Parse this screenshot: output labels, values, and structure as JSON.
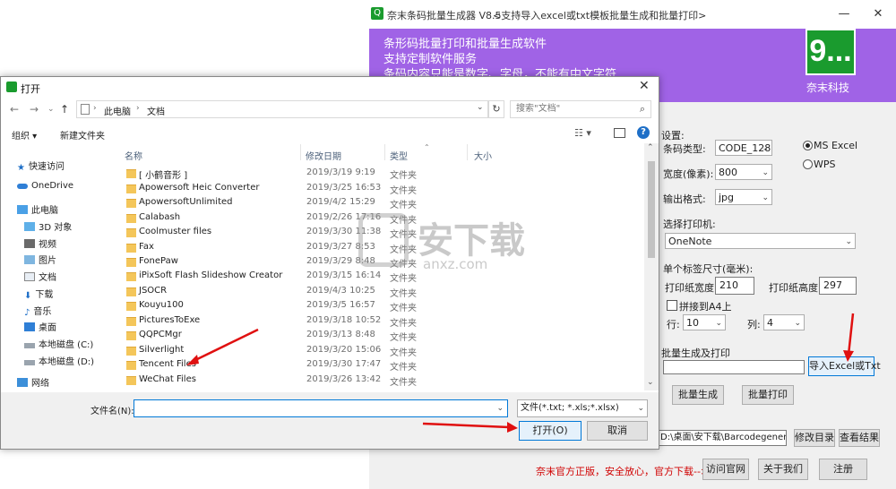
{
  "app": {
    "title": "奈末条码批量生成器 V8.5",
    "subtitle": "<支持导入excel或txt模板批量生成和批量打印>",
    "banner_lines": [
      "条形码批量打印和批量生成软件",
      "支持定制软件服务",
      "条码内容只能是数字、字母，不能有中文字符"
    ],
    "logo": "9...",
    "company": "奈末科技",
    "settings_label": "设置:",
    "barcode_type_label": "条码类型:",
    "barcode_type_value": "CODE_128",
    "width_label": "宽度(像素):",
    "width_value": "800",
    "output_format_label": "输出格式:",
    "output_format_value": "jpg",
    "radio_excel": "MS  Excel",
    "radio_wps": "WPS",
    "printer_label": "选择打印机:",
    "printer_value": "OneNote",
    "label_size_label": "单个标签尺寸(毫米):",
    "paper_width_label": "打印纸宽度:",
    "paper_width_value": "210",
    "paper_height_label": "打印纸高度:",
    "paper_height_value": "297",
    "a4_label": "拼接到A4上",
    "rows_label": "行:",
    "rows_value": "10",
    "cols_label": "列:",
    "cols_value": "4",
    "batch_label": "批量生成及打印",
    "import_button": "导入Excel或Txt",
    "batch_generate_button": "批量生成",
    "batch_print_button": "批量打印",
    "output_path": "D:\\桌面\\安下载\\Barcodegenerato",
    "change_dir_button": "修改目录",
    "view_result_button": "查看结果",
    "footer_text": "奈末官方正版，安全放心，官方下载-->",
    "visit_site_button": "访问官网",
    "about_button": "关于我们",
    "register_button": "注册"
  },
  "dialog": {
    "title": "打开",
    "breadcrumb": [
      "此电脑",
      "文档"
    ],
    "search_placeholder": "搜索\"文档\"",
    "organize": "组织 ▾",
    "new_folder": "新建文件夹",
    "nav_items": [
      {
        "label": "快速访问",
        "icon": "star-icon"
      },
      {
        "label": "OneDrive",
        "icon": "cloud-icon"
      },
      {
        "label": "此电脑",
        "icon": "computer-icon"
      },
      {
        "label": "3D 对象",
        "icon": "cube-icon"
      },
      {
        "label": "视频",
        "icon": "video-icon"
      },
      {
        "label": "图片",
        "icon": "picture-icon"
      },
      {
        "label": "文档",
        "icon": "document-icon"
      },
      {
        "label": "下载",
        "icon": "download-icon"
      },
      {
        "label": "音乐",
        "icon": "music-icon"
      },
      {
        "label": "桌面",
        "icon": "desktop-icon"
      },
      {
        "label": "本地磁盘 (C:)",
        "icon": "drive-icon"
      },
      {
        "label": "本地磁盘 (D:)",
        "icon": "drive-icon"
      },
      {
        "label": "网络",
        "icon": "network-icon"
      }
    ],
    "columns": [
      "名称",
      "修改日期",
      "类型",
      "大小"
    ],
    "files": [
      {
        "name": "[ 小鹤音形 ]",
        "date": "2019/3/19 9:19",
        "type": "文件夹"
      },
      {
        "name": "Apowersoft Heic Converter",
        "date": "2019/3/25 16:53",
        "type": "文件夹"
      },
      {
        "name": "ApowersoftUnlimited",
        "date": "2019/4/2 15:29",
        "type": "文件夹"
      },
      {
        "name": "Calabash",
        "date": "2019/2/26 17:16",
        "type": "文件夹"
      },
      {
        "name": "Coolmuster files",
        "date": "2019/3/30 11:38",
        "type": "文件夹"
      },
      {
        "name": "Fax",
        "date": "2019/3/27 8:53",
        "type": "文件夹"
      },
      {
        "name": "FonePaw",
        "date": "2019/3/29 8:48",
        "type": "文件夹"
      },
      {
        "name": "iPixSoft Flash Slideshow Creator",
        "date": "2019/3/15 16:14",
        "type": "文件夹"
      },
      {
        "name": "JSOCR",
        "date": "2019/4/3 10:25",
        "type": "文件夹"
      },
      {
        "name": "Kouyu100",
        "date": "2019/3/5 16:57",
        "type": "文件夹"
      },
      {
        "name": "PicturesToExe",
        "date": "2019/3/18 10:52",
        "type": "文件夹"
      },
      {
        "name": "QQPCMgr",
        "date": "2019/3/13 8:48",
        "type": "文件夹"
      },
      {
        "name": "Silverlight",
        "date": "2019/3/20 15:06",
        "type": "文件夹"
      },
      {
        "name": "Tencent Files",
        "date": "2019/3/30 17:47",
        "type": "文件夹"
      },
      {
        "name": "WeChat Files",
        "date": "2019/3/26 13:42",
        "type": "文件夹"
      }
    ],
    "filename_label": "文件名(N):",
    "filename_value": "",
    "filter_value": "文件(*.txt; *.xls;*.xlsx)",
    "open_button": "打开(O)",
    "cancel_button": "取消"
  },
  "watermark": {
    "text": "安下载",
    "sub": "anxz.com"
  },
  "colors": {
    "banner": "#a063e6",
    "brand_green": "#1a9b2e",
    "annotation_red": "#e01010",
    "footer_red": "#d00000"
  }
}
